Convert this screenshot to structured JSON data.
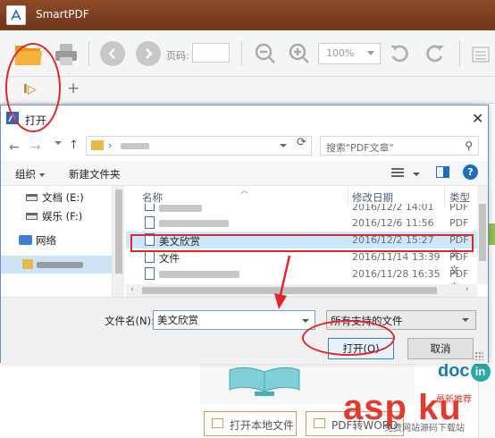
{
  "app": {
    "title": "SmartPDF",
    "toolbar": {
      "page_label": "页码:",
      "zoom_value": "100%"
    },
    "tabs": {
      "play_glyph": "I▷",
      "add_glyph": "+"
    },
    "bottom_buttons": [
      {
        "label": "打开本地文件"
      },
      {
        "label": "PDF转WORD"
      }
    ],
    "right_logo": {
      "text": "doc",
      "suffix": "in"
    },
    "right_text": "最新推荐"
  },
  "watermark": {
    "text": "asp ku",
    "subtext": "免费网站源码下载站"
  },
  "dialog": {
    "title": "打开",
    "close_glyph": "✕",
    "search_placeholder": "搜索\"PDF文章\"",
    "commands": {
      "organize": "组织",
      "new_folder": "新建文件夹",
      "help": "?"
    },
    "nav_pane": {
      "items": [
        {
          "label": "文档 (E:)"
        },
        {
          "label": "娱乐 (F:)"
        },
        {
          "label": "网络"
        }
      ]
    },
    "columns": {
      "name": "名称",
      "modified": "修改日期",
      "type": "类型"
    },
    "files": [
      {
        "name": "",
        "date": "2016/12/2 14:01",
        "type": "PDF 文"
      },
      {
        "name": "",
        "date": "2016/12/6 11:56",
        "type": "PDF 文"
      },
      {
        "name": "美文欣赏",
        "date": "2016/12/2 15:27",
        "type": "PDF 文",
        "selected": true
      },
      {
        "name": "文件",
        "date": "2016/11/14 13:39",
        "type": "PDF 文"
      },
      {
        "name": "",
        "date": "2016/11/28 16:35",
        "type": "PDF 文"
      }
    ],
    "filename_label": "文件名(N):",
    "filename_value": "美文欣赏",
    "filetype_value": "所有支持的文件",
    "open_button": "打开(O)",
    "cancel_button": "取消"
  },
  "colors": {
    "titlebar": "#7a3e1c",
    "accent_blue": "#1f6fb8",
    "annotation_red": "#e0262a",
    "selection": "#cce8ff",
    "folder": "#f0a522"
  },
  "icons": [
    "folder-open-icon",
    "printer-icon",
    "back-icon",
    "forward-icon",
    "zoom-out-icon",
    "zoom-in-icon",
    "rotate-left-icon",
    "rotate-right-icon",
    "search-icon",
    "refresh-icon",
    "pdf-file-icon",
    "help-icon"
  ]
}
